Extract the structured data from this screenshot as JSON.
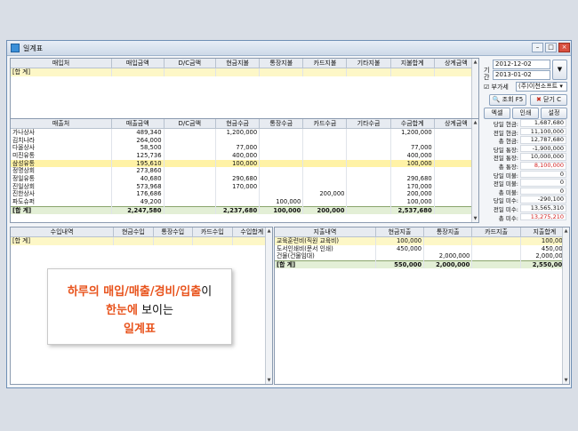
{
  "window": {
    "title": "일계표"
  },
  "purchase": {
    "headers": [
      "매입처",
      "매입금액",
      "D/C금액",
      "현금지불",
      "통장지불",
      "카드지불",
      "기타지불",
      "지불합계",
      "상계금액"
    ],
    "total_label": "[합 계]"
  },
  "controls": {
    "period_label": "기간",
    "date_from": "2012-12-02",
    "date_to": "2013-01-02",
    "check_label": "부가세",
    "company": "(주)이천소프트",
    "search_btn": "조회 F5",
    "close_btn": "닫기 C",
    "excel_btn": "엑셀",
    "print_btn": "인쇄",
    "settings_btn": "설정"
  },
  "sales": {
    "headers": [
      "매출처",
      "매출금액",
      "D/C금액",
      "현금수금",
      "통장수금",
      "카드수금",
      "기타수금",
      "수금합계",
      "상계금액"
    ],
    "rows": [
      [
        "가나상사",
        "489,340",
        "",
        "1,200,000",
        "",
        "",
        "",
        "1,200,000",
        ""
      ],
      [
        "김치나라",
        "264,000",
        "",
        "",
        "",
        "",
        "",
        "",
        ""
      ],
      [
        "다올상사",
        "58,500",
        "",
        "77,000",
        "",
        "",
        "",
        "77,000",
        ""
      ],
      [
        "미진유통",
        "125,736",
        "",
        "400,000",
        "",
        "",
        "",
        "400,000",
        ""
      ],
      [
        "삼성유통",
        "195,610",
        "",
        "100,000",
        "",
        "",
        "",
        "100,000",
        ""
      ],
      [
        "정명상회",
        "273,860",
        "",
        "",
        "",
        "",
        "",
        "",
        ""
      ],
      [
        "정일유통",
        "40,680",
        "",
        "290,680",
        "",
        "",
        "",
        "290,680",
        ""
      ],
      [
        "진일상회",
        "573,968",
        "",
        "170,000",
        "",
        "",
        "",
        "170,000",
        ""
      ],
      [
        "진한상사",
        "176,686",
        "",
        "",
        "",
        "200,000",
        "",
        "200,000",
        ""
      ],
      [
        "파도슈퍼",
        "49,200",
        "",
        "",
        "100,000",
        "",
        "",
        "100,000",
        ""
      ]
    ],
    "total": [
      "[합 계]",
      "2,247,580",
      "",
      "2,237,680",
      "100,000",
      "200,000",
      "",
      "2,537,680",
      ""
    ]
  },
  "summary": [
    {
      "label": "당일 현금:",
      "value": "1,687,680",
      "color": "#111111"
    },
    {
      "label": "전일 현금:",
      "value": "11,100,000",
      "color": "#111111"
    },
    {
      "label": "총 현금:",
      "value": "12,787,680",
      "color": "#111111"
    },
    {
      "label": "당일 통장:",
      "value": "-1,900,000",
      "color": "#111111"
    },
    {
      "label": "전일 통장:",
      "value": "10,000,000",
      "color": "#111111"
    },
    {
      "label": "총 통장:",
      "value": "8,100,000",
      "color": "#d11f1f"
    },
    {
      "label": "당일 미불:",
      "value": "0",
      "color": "#111111"
    },
    {
      "label": "전일 미불:",
      "value": "0",
      "color": "#111111"
    },
    {
      "label": "총 미불:",
      "value": "0",
      "color": "#111111"
    },
    {
      "label": "당일 미수:",
      "value": "-290,100",
      "color": "#111111"
    },
    {
      "label": "전일 미수:",
      "value": "13,565,310",
      "color": "#111111"
    },
    {
      "label": "총 미수:",
      "value": "13,275,210",
      "color": "#d11f1f"
    }
  ],
  "income": {
    "headers": [
      "수입내역",
      "현금수입",
      "통장수입",
      "카드수입",
      "수입합계"
    ],
    "total_label": "[합 계]"
  },
  "expense": {
    "headers": [
      "지출내역",
      "현금지출",
      "통장지출",
      "카드지출",
      "지출합계"
    ],
    "rows": [
      [
        "교육훈련비(직원 교육비)",
        "100,000",
        "",
        "",
        "100,000"
      ],
      [
        "도서인쇄비(문서 인쇄)",
        "450,000",
        "",
        "",
        "450,000"
      ],
      [
        "건물(건물임대)",
        "",
        "2,000,000",
        "",
        "2,000,000"
      ]
    ],
    "total": [
      "[합 계]",
      "550,000",
      "2,000,000",
      "",
      "2,550,000"
    ]
  },
  "callout": {
    "line1_a": "하루의 매입/매출/경비/입출",
    "line1_b": "이",
    "line2_a": "한눈에",
    "line2_b": " 보이는",
    "line3": "일계표"
  }
}
